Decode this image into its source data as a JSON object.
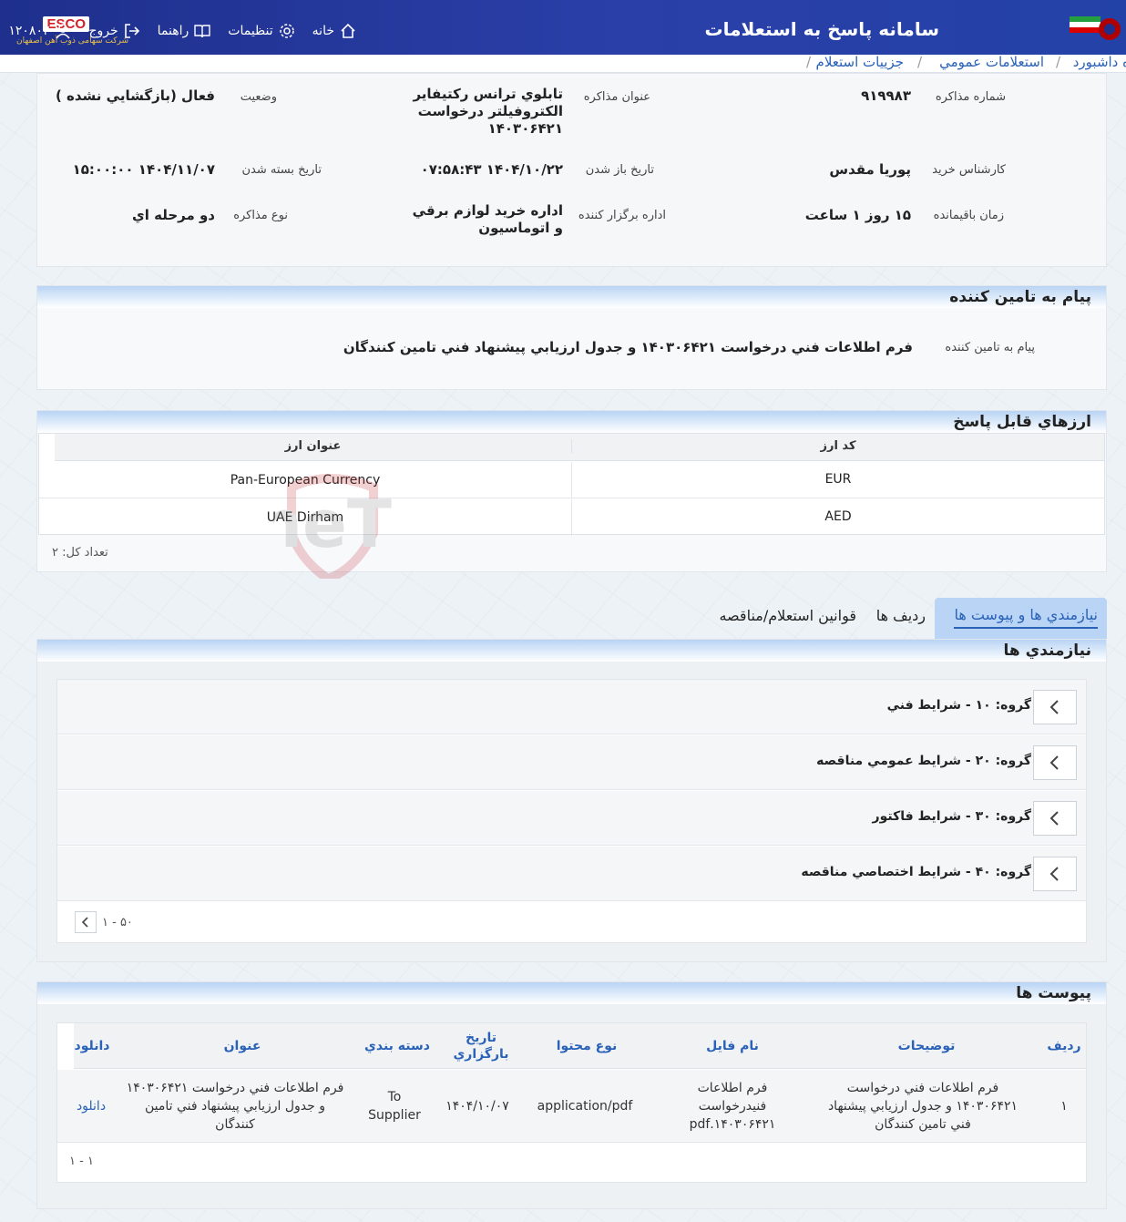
{
  "header": {
    "app_title": "سامانه پاسخ به استعلامات",
    "esco_badge": "ESCO",
    "company_sub": "شرکت سهامی ذوب آهن اصفهان",
    "nav": [
      {
        "label": "خانه",
        "icon": "home-icon"
      },
      {
        "label": "تنظيمات",
        "icon": "gear-icon"
      },
      {
        "label": "راهنما",
        "icon": "book-icon"
      },
      {
        "label": "خروج",
        "icon": "logout-icon"
      },
      {
        "label": "۱۲۰۸۰۲",
        "icon": "user-icon"
      }
    ]
  },
  "breadcrumb": {
    "items": [
      "ه داشبورد",
      "استعلامات عمومي",
      "جزييات استعلام"
    ],
    "sep": "/"
  },
  "details": {
    "fields": [
      {
        "label": "شماره مذاکره",
        "value": "۹۱۹۹۸۳"
      },
      {
        "label": "عنوان مذاکره",
        "value": "تابلوي ترانس ركتيفاير الكتروفيلتر درخواست ۱۴۰۳۰۶۴۲۱"
      },
      {
        "label": "وضعيت",
        "value": "فعال (بازگشايي نشده )"
      },
      {
        "label": "کارشناس خريد",
        "value": "پوريا مقدس"
      },
      {
        "label": "تاريخ باز شدن",
        "value": "۱۴۰۴/۱۰/۲۲ ۰۷:۵۸:۴۳"
      },
      {
        "label": "تاريخ بسته شدن",
        "value": "۱۴۰۴/۱۱/۰۷ ۱۵:۰۰:۰۰"
      },
      {
        "label": "زمان باقيمانده",
        "value": "۱۵ روز ۱ ساعت"
      },
      {
        "label": "اداره برگزار کننده",
        "value": "اداره خريد لوازم برقي و اتوماسيون"
      },
      {
        "label": "نوع مذاکره",
        "value": "دو مرحله اي"
      }
    ]
  },
  "message": {
    "title": "پيام به تامين کننده",
    "label": "پيام به تامين کننده",
    "value": "فرم اطلاعات فني درخواست ۱۴۰۳۰۶۴۲۱ و جدول ارزيابي پيشنهاد فني تامين کنندگان"
  },
  "currencies": {
    "title": "ارزهاي قابل پاسخ",
    "columns": [
      "کد ارز",
      "عنوان ارز"
    ],
    "rows": [
      {
        "code": "EUR",
        "name": "Pan-European Currency"
      },
      {
        "code": "AED",
        "name": "UAE Dirham"
      }
    ],
    "total": "تعداد کل: ۲"
  },
  "watermark": "AriaTender.neT",
  "tabs": [
    {
      "label": "نيازمندي ها و پيوست ها",
      "active": true
    },
    {
      "label": "رديف ها",
      "active": false
    },
    {
      "label": "قوانين استعلام/مناقصه",
      "active": false
    }
  ],
  "requirements": {
    "title": "نيازمندي ها",
    "groups": [
      "گروه: ۱۰ - شرايط فني",
      "گروه: ۲۰ - شرايط عمومي مناقصه",
      "گروه: ۳۰ - شرايط فاکتور",
      "گروه: ۴۰ - شرايط اختصاصي مناقصه"
    ],
    "pager": "۱ - ۵۰"
  },
  "attachments": {
    "title": "پيوست ها",
    "columns": [
      "رديف",
      "توضيحات",
      "نام فايل",
      "نوع محتوا",
      "تاريخ بارگزاري",
      "دسته بندي",
      "عنوان",
      "دانلود"
    ],
    "rows": [
      {
        "index": "۱",
        "desc": "فرم اطلاعات فني درخواست ۱۴۰۳۰۶۴۲۱ و جدول ارزيابي پيشنهاد فني تامين کنندگان",
        "file": "فرم اطلاعات فنيدرخواست ۱۴۰۳۰۶۴۲۱.pdf",
        "mime": "application/pdf",
        "date": "۱۴۰۴/۱۰/۰۷",
        "category": "To Supplier",
        "title": "فرم اطلاعات فني درخواست ۱۴۰۳۰۶۴۲۱ و جدول ارزيابي پيشنهاد فني تامين کنندگان",
        "download": "دانلود"
      }
    ],
    "pager": "۱ - ۱"
  },
  "colors": {
    "brand": "#1e2f8c",
    "link": "#2a62b8",
    "panel_head": "#b9d4f4"
  }
}
